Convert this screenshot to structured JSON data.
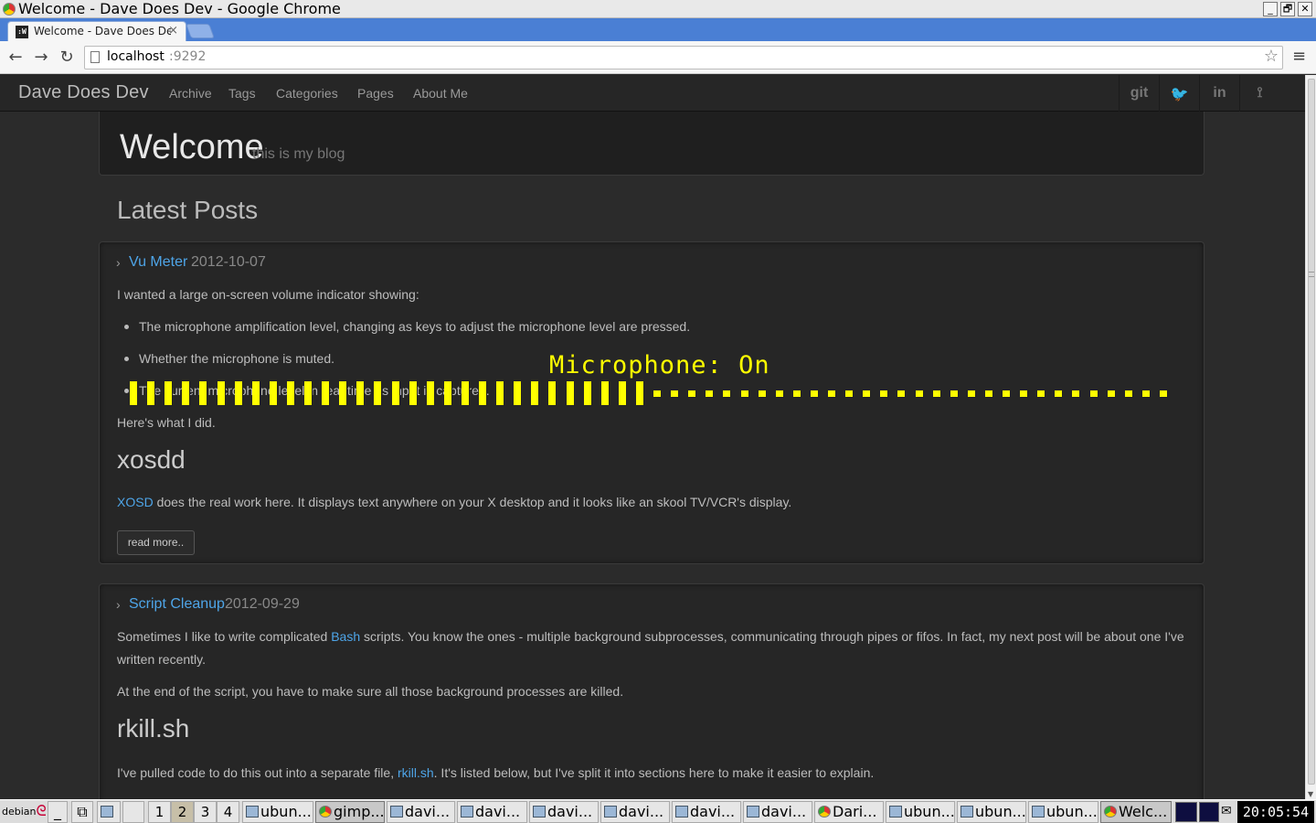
{
  "window": {
    "title": "Welcome - Dave Does Dev - Google Chrome",
    "minimize": "_",
    "restore": "🗗",
    "close": "✕"
  },
  "browser": {
    "tab_title": "Welcome - Dave Does Dev",
    "tab_favicon": ":W",
    "tab_close": "×",
    "url_host": "localhost",
    "url_port": ":9292",
    "back": "←",
    "forward": "→",
    "reload": "↻",
    "star": "☆",
    "menu": "≡"
  },
  "site": {
    "brand": "Dave Does Dev",
    "nav": [
      "Archive",
      "Tags",
      "Categories",
      "Pages",
      "About Me"
    ],
    "social": [
      "git",
      "twitter-icon",
      "linkedin-icon",
      "rss-icon"
    ],
    "social_glyphs": {
      "git": "git",
      "twitter": "🐦",
      "linkedin": "in",
      "rss": "⟟"
    },
    "hero_title": "Welcome",
    "hero_tagline": "this is my blog",
    "latest_heading": "Latest Posts"
  },
  "posts": [
    {
      "title": "Vu Meter",
      "date": "2012-10-07",
      "intro": "I wanted a large on-screen volume indicator showing:",
      "bullets": [
        "The microphone amplification level, changing as keys to adjust the microphone level are pressed.",
        "Whether the microphone is muted.",
        "The current microphone level in real-time as input is captured."
      ],
      "after": "Here's what I did.",
      "section": "xosdd",
      "section_link": "XOSD",
      "section_text": " does the real work here. It displays text anywhere on your X desktop and it looks like an skool TV/VCR's display.",
      "more": "read more.."
    },
    {
      "title": "Script Cleanup",
      "date": "2012-09-29",
      "p1_a": "Sometimes I like to write complicated ",
      "p1_link": "Bash",
      "p1_b": " scripts. You know the ones - multiple background subprocesses, communicating through pipes or fifos. In fact, my next post will be about one I've written recently.",
      "p2": "At the end of the script, you have to make sure all those background processes are killed.",
      "section": "rkill.sh",
      "p3_a": "I've pulled code to do this out into a separate file, ",
      "p3_link": "rkill.sh",
      "p3_b": ". It's listed below, but I've split it into sections here to make it easier to explain."
    }
  ],
  "osd": {
    "text": "Microphone: On",
    "color": "#ffff00",
    "level_fraction": 0.5,
    "segments": 60
  },
  "taskbar": {
    "start": "debian",
    "desktops": [
      "1",
      "2",
      "3",
      "4"
    ],
    "active_desktop": "2",
    "tasks": [
      {
        "label": "ubun...",
        "icon": "terminal"
      },
      {
        "label": "gimp...",
        "icon": "chrome",
        "selected": true
      },
      {
        "label": "davi...",
        "icon": "terminal"
      },
      {
        "label": "davi...",
        "icon": "terminal"
      },
      {
        "label": "davi...",
        "icon": "terminal"
      },
      {
        "label": "davi...",
        "icon": "terminal"
      },
      {
        "label": "davi...",
        "icon": "terminal"
      },
      {
        "label": "davi...",
        "icon": "terminal"
      },
      {
        "label": "Dari...",
        "icon": "chrome"
      },
      {
        "label": "ubun...",
        "icon": "terminal"
      },
      {
        "label": "ubun...",
        "icon": "terminal"
      },
      {
        "label": "ubun...",
        "icon": "terminal"
      },
      {
        "label": "Welc...",
        "icon": "chrome",
        "active": true
      }
    ],
    "clock": "20:05:54"
  }
}
